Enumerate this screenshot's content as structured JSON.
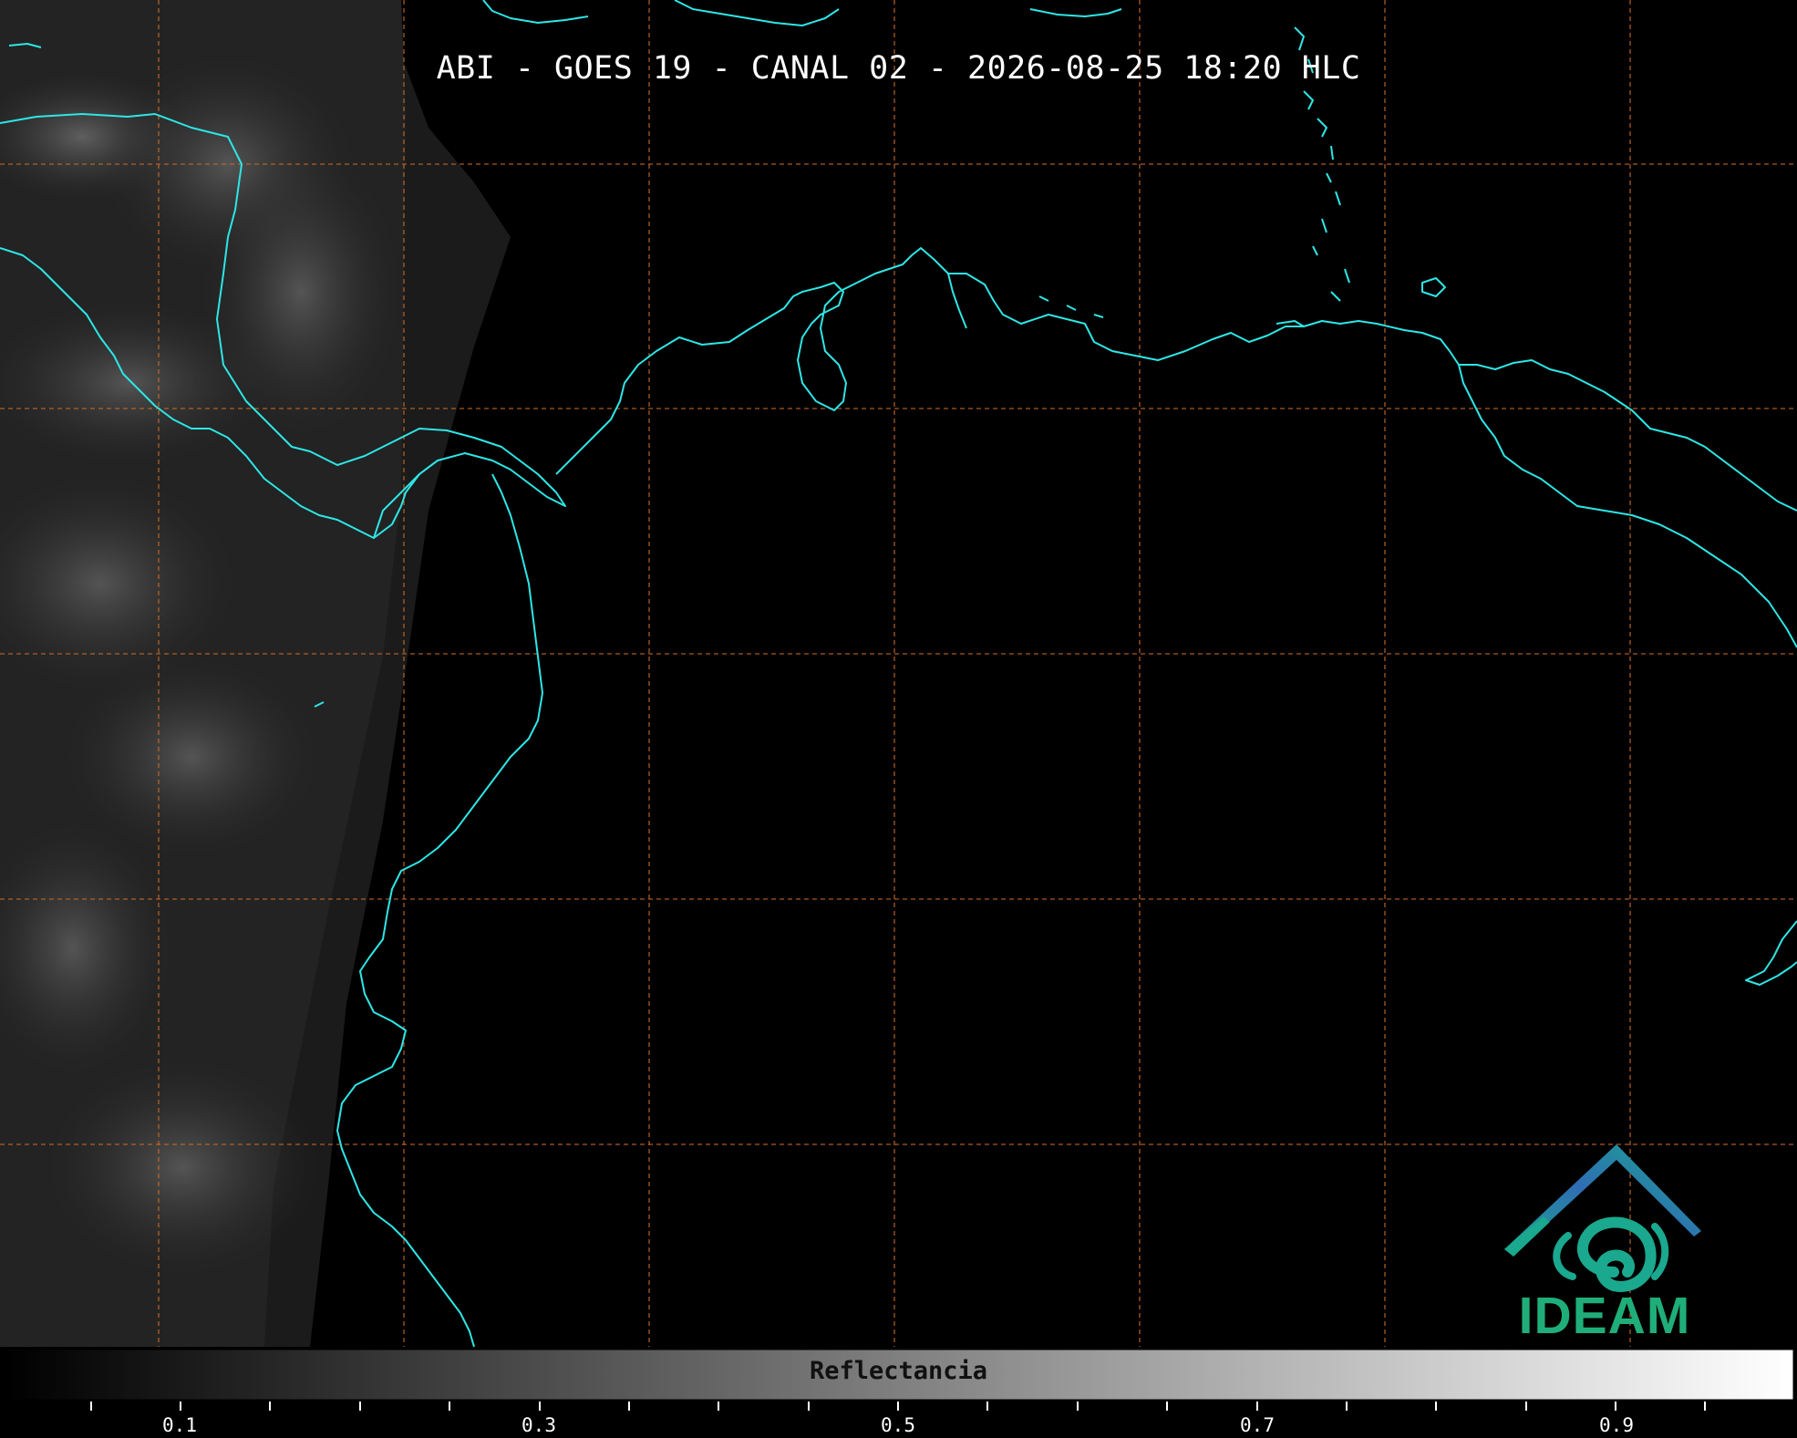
{
  "title": "ABI - GOES 19 - CANAL 02 - 2026-08-25 18:20 HLC",
  "colorbar": {
    "label": "Reflectancia",
    "min": 0.0,
    "max": 1.0,
    "tick_labels": [
      "0.1",
      "0.3",
      "0.5",
      "0.7",
      "0.9"
    ],
    "tick_values": [
      0.1,
      0.3,
      0.5,
      0.7,
      0.9
    ],
    "minor_tick_step": 0.05,
    "gradient_start_color": "#000000",
    "gradient_end_color": "#ffffff"
  },
  "map": {
    "coastline_color": "#2ee6e6",
    "gridline_color": "#c86a28",
    "gridline_style": "dashed",
    "background_color": "#000000"
  },
  "logo": {
    "text": "IDEAM",
    "text_color": "#1fae7a",
    "roof_color_start": "#2f6db4",
    "roof_color_end": "#1aa88e"
  }
}
